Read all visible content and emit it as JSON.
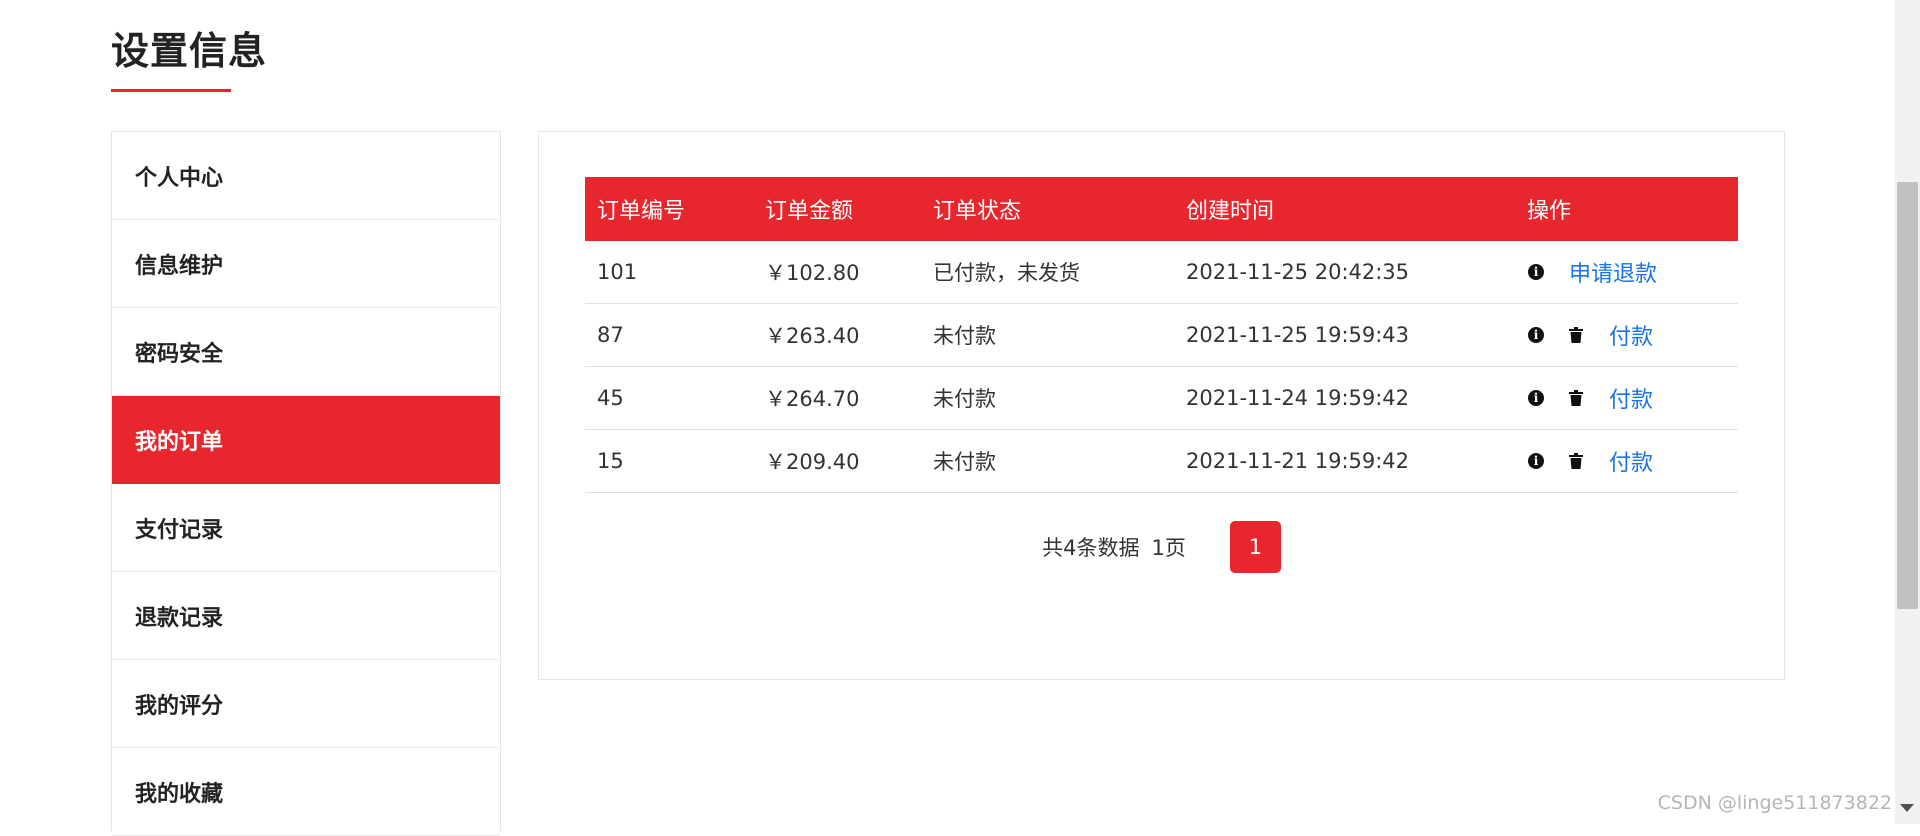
{
  "page": {
    "title": "设置信息"
  },
  "colors": {
    "accent": "#e8262d",
    "link": "#1a73e8"
  },
  "sidebar": {
    "items": [
      {
        "label": "个人中心",
        "active": false
      },
      {
        "label": "信息维护",
        "active": false
      },
      {
        "label": "密码安全",
        "active": false
      },
      {
        "label": "我的订单",
        "active": true
      },
      {
        "label": "支付记录",
        "active": false
      },
      {
        "label": "退款记录",
        "active": false
      },
      {
        "label": "我的评分",
        "active": false
      },
      {
        "label": "我的收藏",
        "active": false
      }
    ]
  },
  "orders": {
    "columns": [
      "订单编号",
      "订单金额",
      "订单状态",
      "创建时间",
      "操作"
    ],
    "rows": [
      {
        "id": "101",
        "amount": "￥102.80",
        "status": "已付款，未发货",
        "created": "2021-11-25 20:42:35",
        "icons": [
          "info-icon"
        ],
        "action": "申请退款"
      },
      {
        "id": "87",
        "amount": "￥263.40",
        "status": "未付款",
        "created": "2021-11-25 19:59:43",
        "icons": [
          "info-icon",
          "trash-icon"
        ],
        "action": "付款"
      },
      {
        "id": "45",
        "amount": "￥264.70",
        "status": "未付款",
        "created": "2021-11-24 19:59:42",
        "icons": [
          "info-icon",
          "trash-icon"
        ],
        "action": "付款"
      },
      {
        "id": "15",
        "amount": "￥209.40",
        "status": "未付款",
        "created": "2021-11-21 19:59:42",
        "icons": [
          "info-icon",
          "trash-icon"
        ],
        "action": "付款"
      }
    ]
  },
  "pagination": {
    "total": "共4条数据",
    "pages": "1页",
    "current": "1"
  },
  "watermark": "CSDN @linge511873822"
}
